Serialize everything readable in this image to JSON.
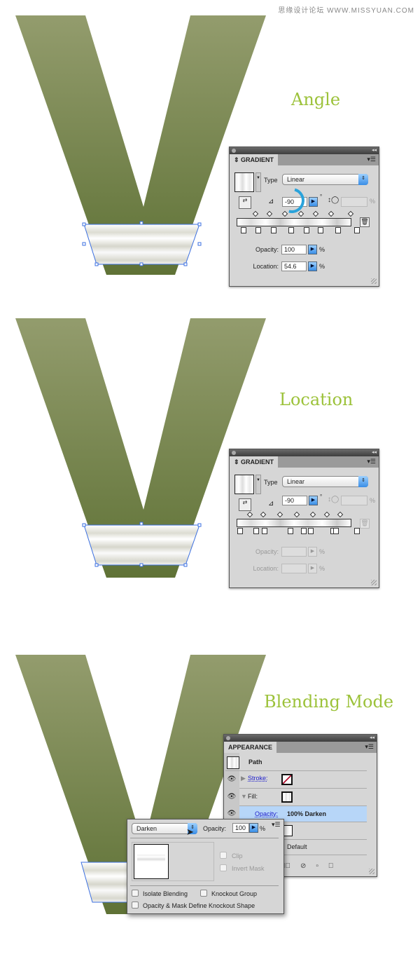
{
  "watermark": "思缘设计论坛 WWW.MISSYUAN.COM",
  "colors": {
    "heading": "#9cc23a",
    "v_top": "#939c6d",
    "v_bottom": "#5f7236",
    "selection": "#3b6fe0",
    "accent_blue": "#3a8ee6",
    "highlight_row": "#b7d6f8"
  },
  "sections": [
    {
      "heading": "Angle",
      "panel": {
        "tab": "GRADIENT",
        "type_label": "Type",
        "type_value": "Linear",
        "angle": "-90",
        "degree_symbol": "°",
        "aspect_unit": "%",
        "opacity_label": "Opacity:",
        "opacity": "100",
        "location_label": "Location:",
        "location": "54.6",
        "percent": "%",
        "enabled": true,
        "angle_highlighted": true
      }
    },
    {
      "heading": "Location",
      "panel": {
        "tab": "GRADIENT",
        "type_label": "Type",
        "type_value": "Linear",
        "angle": "-90",
        "degree_symbol": "°",
        "aspect_unit": "%",
        "opacity_label": "Opacity:",
        "opacity": "",
        "location_label": "Location:",
        "location": "",
        "percent": "%",
        "enabled": false
      }
    },
    {
      "heading": "Blending Mode"
    }
  ],
  "appearance": {
    "tab": "APPEARANCE",
    "path_label": "Path",
    "stroke_label": "Stroke:",
    "fill_label": "Fill:",
    "opacity_label": "Opacity:",
    "opacity_value": "100% Darken",
    "default_label": "Default"
  },
  "transparency_popup": {
    "blend_mode": "Darken",
    "opacity_label": "Opacity:",
    "opacity": "100",
    "percent": "%",
    "clip_label": "Clip",
    "invert_mask_label": "Invert Mask",
    "isolate_label": "Isolate Blending",
    "knockout_label": "Knockout Group",
    "define_knockout_label": "Opacity & Mask Define Knockout Shape"
  }
}
